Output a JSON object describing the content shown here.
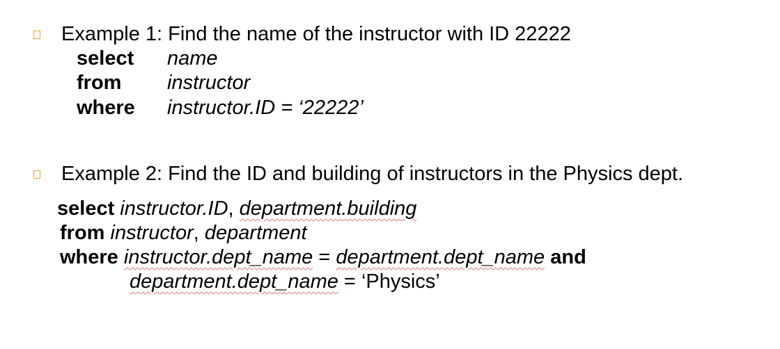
{
  "accent_color": "#e8a23a",
  "bullet_icon": "hollow-square-bullet-icon",
  "example1": {
    "heading": "Example 1: Find the name of the instructor with ID 22222",
    "rows": [
      {
        "keyword": "select",
        "value": "name"
      },
      {
        "keyword": "from",
        "value": "instructor"
      },
      {
        "keyword": "where",
        "value": "instructor.ID = ‘22222’"
      }
    ]
  },
  "example2": {
    "heading": "Example 2: Find the ID and building of instructors in the Physics dept.",
    "line1": {
      "keyword": "select",
      "part1": "instructor.ID",
      "sep": ", ",
      "part2": "department.building"
    },
    "line2": {
      "keyword": "from",
      "part1": "instructor",
      "sep": ", ",
      "part2": "department"
    },
    "line3": {
      "keyword": "where",
      "left": "instructor.dept_name",
      "op": " = ",
      "right": "department.dept_name",
      "conj": "and"
    },
    "line4": {
      "left": "department.dept_name",
      "op": " = ",
      "value": "‘Physics’"
    }
  }
}
